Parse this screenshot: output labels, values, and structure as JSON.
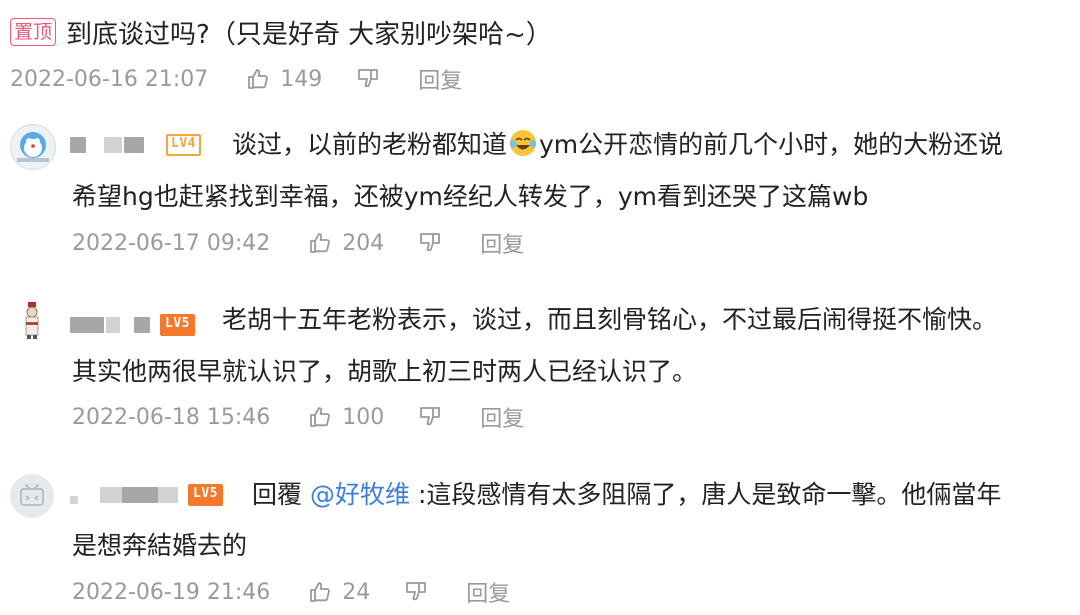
{
  "pinned": {
    "tag": "置顶",
    "text": "到底谈过吗?（只是好奇 大家别吵架哈~）",
    "date": "2022-06-16 21:07",
    "likes": "149",
    "reply_label": "回复"
  },
  "comments": [
    {
      "level": "LV4",
      "line1_a": "谈过，以前的老粉都知道",
      "emoji": "laughing-crying-emoji",
      "line1_b": "ym公开恋情的前几个小时，她的大粉还说",
      "line2": "希望hg也赶紧找到幸福，还被ym经纪人转发了，ym看到还哭了这篇wb",
      "date": "2022-06-17 09:42",
      "likes": "204",
      "reply_label": "回复"
    },
    {
      "level": "LV5",
      "line1": "老胡十五年老粉表示，谈过，而且刻骨铭心，不过最后闹得挺不愉快。",
      "line2": "其实他两很早就认识了，胡歌上初三时两人已经认识了。",
      "date": "2022-06-18 15:46",
      "likes": "100",
      "reply_label": "回复"
    },
    {
      "level": "LV5",
      "reply_prefix": "回覆",
      "mention": "@好牧维",
      "line1_rest": ":這段感情有太多阻隔了，唐人是致命一擊。他倆當年",
      "line2": "是想奔結婚去的",
      "date": "2022-06-19 21:46",
      "likes": "24",
      "reply_label": "回复"
    }
  ],
  "colors": {
    "pin_tag": "#e95a7a",
    "meta_text": "#9a9a9a",
    "mention": "#3d7fd6",
    "level_badge": "#f4792a"
  }
}
